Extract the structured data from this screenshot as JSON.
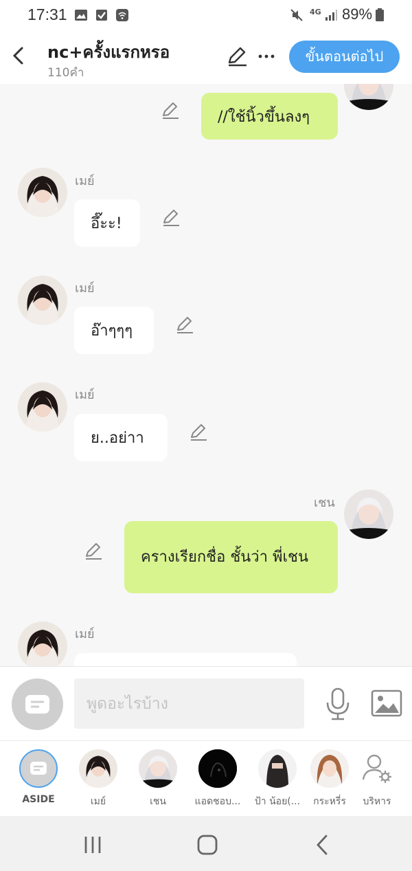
{
  "status_bar": {
    "time": "17:31",
    "battery": "89%",
    "network": "4G"
  },
  "header": {
    "title": "nc+ครั้งแรกหรอ",
    "word_count": "110คำ",
    "next_label": "ขั้นตอนต่อไป"
  },
  "messages": [
    {
      "text": "//ใช้นิ้วขึ้นลงๆ",
      "side": "right"
    },
    {
      "sender": "เมย์",
      "text": "อึ๊ะะ!",
      "side": "left"
    },
    {
      "sender": "เมย์",
      "text": "อ๊าๆๆๆ",
      "side": "left"
    },
    {
      "sender": "เมย์",
      "text": "ย..อย่าา",
      "side": "left"
    },
    {
      "sender": "เชน",
      "text": "ครางเรียกชื่อ ชั้นว่า พี่เชน",
      "side": "right"
    },
    {
      "sender": "เมย์",
      "text": "",
      "side": "left"
    }
  ],
  "input": {
    "placeholder": "พูดอะไรบ้าง"
  },
  "characters": [
    {
      "label": "ASIDE"
    },
    {
      "label": "เมย์"
    },
    {
      "label": "เชน"
    },
    {
      "label": "แอดชอบ..."
    },
    {
      "label": "ป้า น้อย(..."
    },
    {
      "label": "กระหรี่ร"
    },
    {
      "label": "บริหาร"
    }
  ],
  "colors": {
    "accent": "#4da3ef",
    "right_bubble": "#d8f48f",
    "left_bubble": "#ffffff",
    "background": "#f7f7f7"
  },
  "icons": [
    "back-arrow",
    "pencil",
    "more-dots",
    "mic",
    "image",
    "manage-user-gear"
  ]
}
